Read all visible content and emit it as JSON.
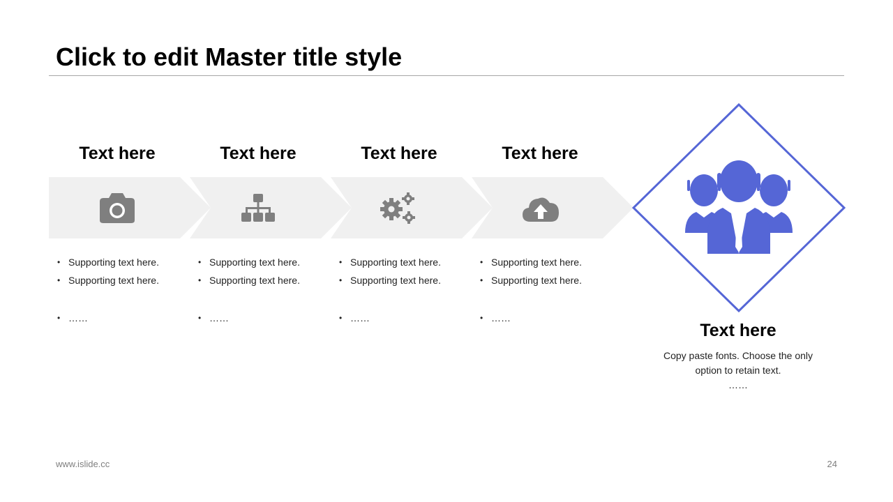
{
  "slide": {
    "title": "Click to edit Master title style",
    "footer_url": "www.islide.cc",
    "page_number": "24"
  },
  "steps": [
    {
      "heading": "Text here",
      "icon": "camera-icon",
      "bullets": [
        "Supporting text here.",
        "Supporting text here.",
        "……"
      ]
    },
    {
      "heading": "Text here",
      "icon": "hierarchy-icon",
      "bullets": [
        "Supporting text here.",
        "Supporting text here.",
        "……"
      ]
    },
    {
      "heading": "Text here",
      "icon": "gears-icon",
      "bullets": [
        "Supporting text here.",
        "Supporting text here.",
        "……"
      ]
    },
    {
      "heading": "Text here",
      "icon": "cloud-upload-icon",
      "bullets": [
        "Supporting text here.",
        "Supporting text here.",
        "……"
      ]
    }
  ],
  "final": {
    "heading": "Text here",
    "description_line1": "Copy paste fonts. Choose the only",
    "description_line2": "option to retain text.",
    "description_line3": "……",
    "icon": "team-icon"
  },
  "colors": {
    "accent": "#5566d6",
    "chevron_fill": "#f0f0f0",
    "icon_gray": "#7f7f7f",
    "rule": "#a6a6a6"
  }
}
